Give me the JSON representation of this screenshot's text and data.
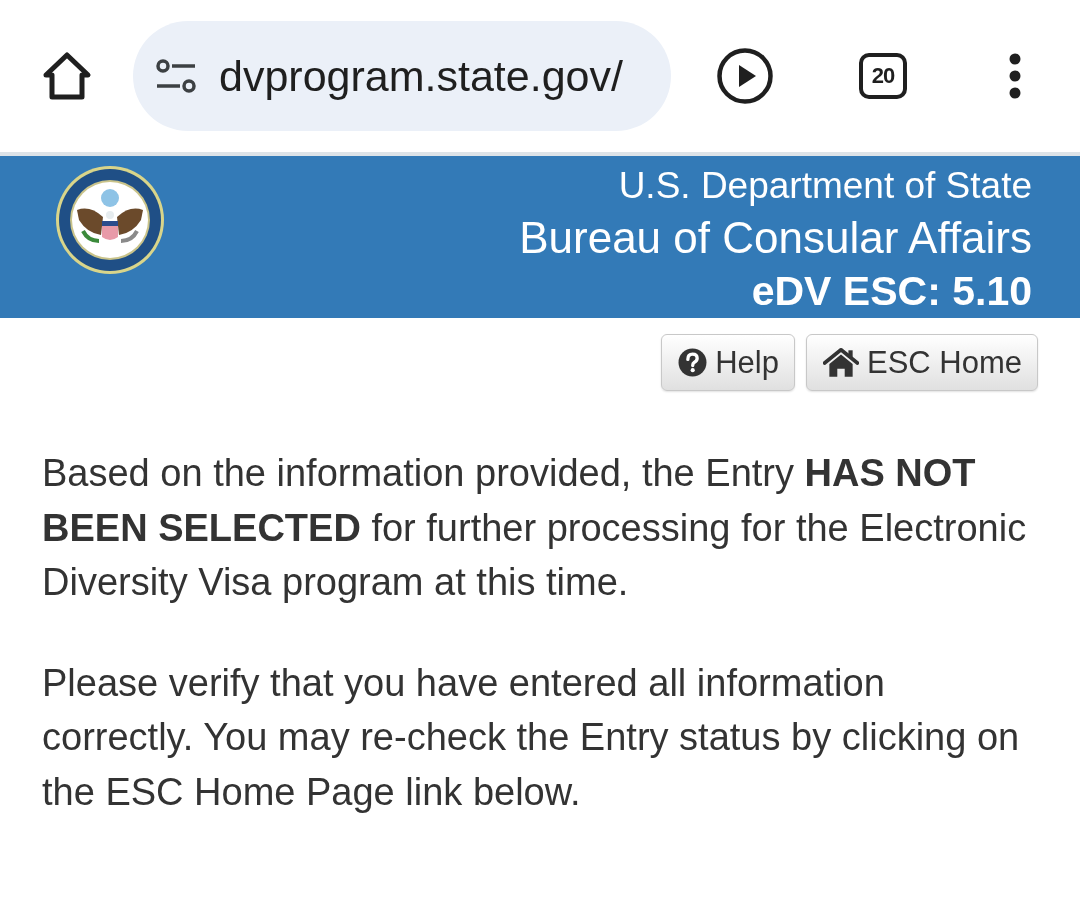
{
  "browser": {
    "url": "dvprogram.state.gov/",
    "tab_count": "20"
  },
  "header": {
    "lines": [
      "U.S. Department of State",
      "Bureau of Consular Affairs",
      "eDV ESC: 5.10"
    ]
  },
  "toolbar": {
    "buttons": [
      {
        "label": "Help",
        "kind": "help"
      },
      {
        "label": "ESC Home",
        "kind": "home"
      }
    ]
  },
  "paragraphs": [
    "Based on the information provided, the Entry **HAS NOT BEEN SELECTED** for further processing for the Electronic Diversity Visa program at this time.",
    "Please verify that you have entered all information correctly. You may re-check the Entry status by clicking on the ESC Home Page link below."
  ]
}
